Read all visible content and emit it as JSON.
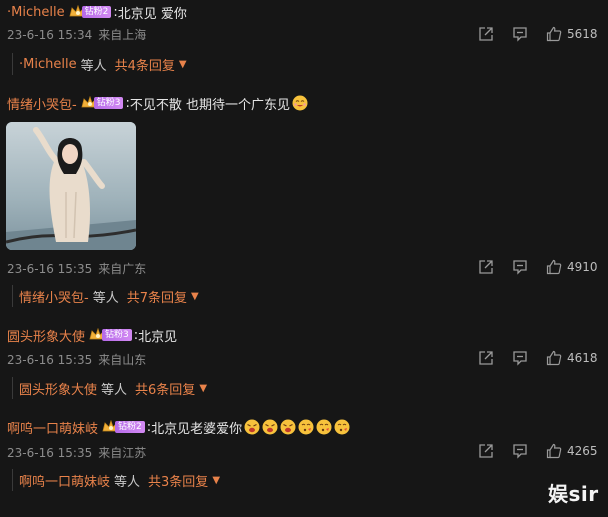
{
  "comments": [
    {
      "username": "·Michelle",
      "badge": "钻粉2",
      "text": "北京见 爱你",
      "date": "23-6-16 15:34",
      "location": "来自上海",
      "likes": "5618",
      "sub": {
        "who": "·Michelle",
        "deng": "等人",
        "more": "共4条回复"
      }
    },
    {
      "username": "情绪小哭包-",
      "badge": "钻粉3",
      "text": "不见不散 也期待一个广东见",
      "date": "23-6-16 15:35",
      "location": "来自广东",
      "likes": "4910",
      "sub": {
        "who": "情绪小哭包-",
        "deng": "等人",
        "more": "共7条回复"
      }
    },
    {
      "username": "圆头形象大使",
      "badge": "钻粉3",
      "text": "北京见",
      "date": "23-6-16 15:35",
      "location": "来自山东",
      "likes": "4618",
      "sub": {
        "who": "圆头形象大使",
        "deng": "等人",
        "more": "共6条回复"
      }
    },
    {
      "username": "啊呜一口萌妹岐",
      "badge": "钻粉2",
      "text": "北京见老婆爱你",
      "date": "23-6-16 15:35",
      "location": "来自江苏",
      "likes": "4265",
      "sub": {
        "who": "啊呜一口萌妹岐",
        "deng": "等人",
        "more": "共3条回复"
      }
    }
  ],
  "colon": ":",
  "watermark": "娱sir",
  "icons": [
    "crown-icon",
    "share-icon",
    "comment-icon",
    "like-icon",
    "caret-down-icon",
    "emoji-icon"
  ],
  "colors": {
    "username": "#e8824a",
    "background": "#161616",
    "badge": "#c47af0"
  }
}
